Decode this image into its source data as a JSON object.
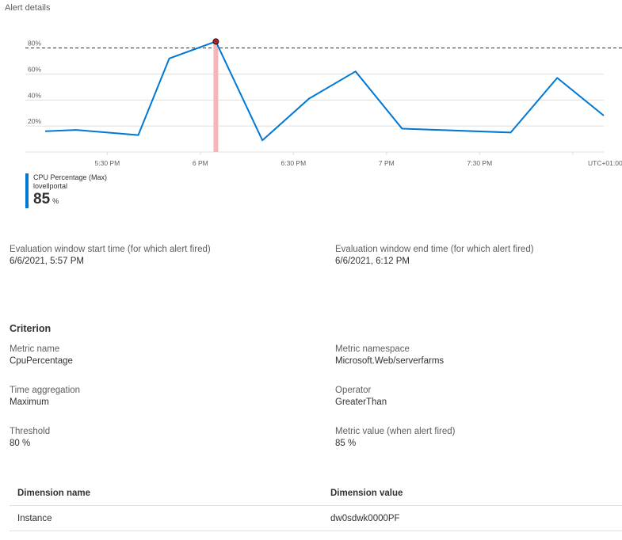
{
  "header": {
    "section_title": "Alert details"
  },
  "chart_data": {
    "type": "line",
    "x": [
      "5:10 PM",
      "5:20 PM",
      "5:40 PM",
      "5:50 PM",
      "6:05 PM",
      "6:20 PM",
      "6:35 PM",
      "6:50 PM",
      "7:05 PM",
      "7:40 PM",
      "7:55 PM",
      "8:10 PM"
    ],
    "series": [
      {
        "name": "CPU Percentage (Max)",
        "values": [
          16,
          17,
          13,
          72,
          85,
          9,
          41,
          62,
          18,
          15,
          57,
          28
        ]
      }
    ],
    "x_tick_labels": [
      "5:30 PM",
      "6 PM",
      "6:30 PM",
      "7 PM",
      "7:30 PM",
      "UTC+01:00"
    ],
    "y_tick_labels": [
      "20%",
      "40%",
      "60%",
      "80%"
    ],
    "ylim": [
      0,
      95
    ],
    "threshold": 80,
    "alert_point": {
      "x": "6:05 PM",
      "value": 85
    },
    "grid": true,
    "colors": {
      "line": "#0078d4",
      "threshold": "#323130",
      "alert_band": "#f4b6b6",
      "alert_dot": "#a4262c",
      "grid": "#e1dfdd"
    }
  },
  "legend": {
    "metric_label": "CPU Percentage (Max)",
    "resource": "lovellportal",
    "value": "85",
    "unit": "%"
  },
  "evaluation": {
    "start_label": "Evaluation window start time (for which alert fired)",
    "start_value": "6/6/2021, 5:57 PM",
    "end_label": "Evaluation window end time (for which alert fired)",
    "end_value": "6/6/2021, 6:12 PM"
  },
  "criterion": {
    "title": "Criterion",
    "metric_name_label": "Metric name",
    "metric_name_value": "CpuPercentage",
    "metric_namespace_label": "Metric namespace",
    "metric_namespace_value": "Microsoft.Web/serverfarms",
    "time_aggregation_label": "Time aggregation",
    "time_aggregation_value": "Maximum",
    "operator_label": "Operator",
    "operator_value": "GreaterThan",
    "threshold_label": "Threshold",
    "threshold_value": "80 %",
    "metric_value_label": "Metric value (when alert fired)",
    "metric_value_value": "85 %"
  },
  "dimensions": {
    "header_name": "Dimension name",
    "header_value": "Dimension value",
    "rows": [
      {
        "name": "Instance",
        "value": "dw0sdwk0000PF"
      }
    ]
  }
}
